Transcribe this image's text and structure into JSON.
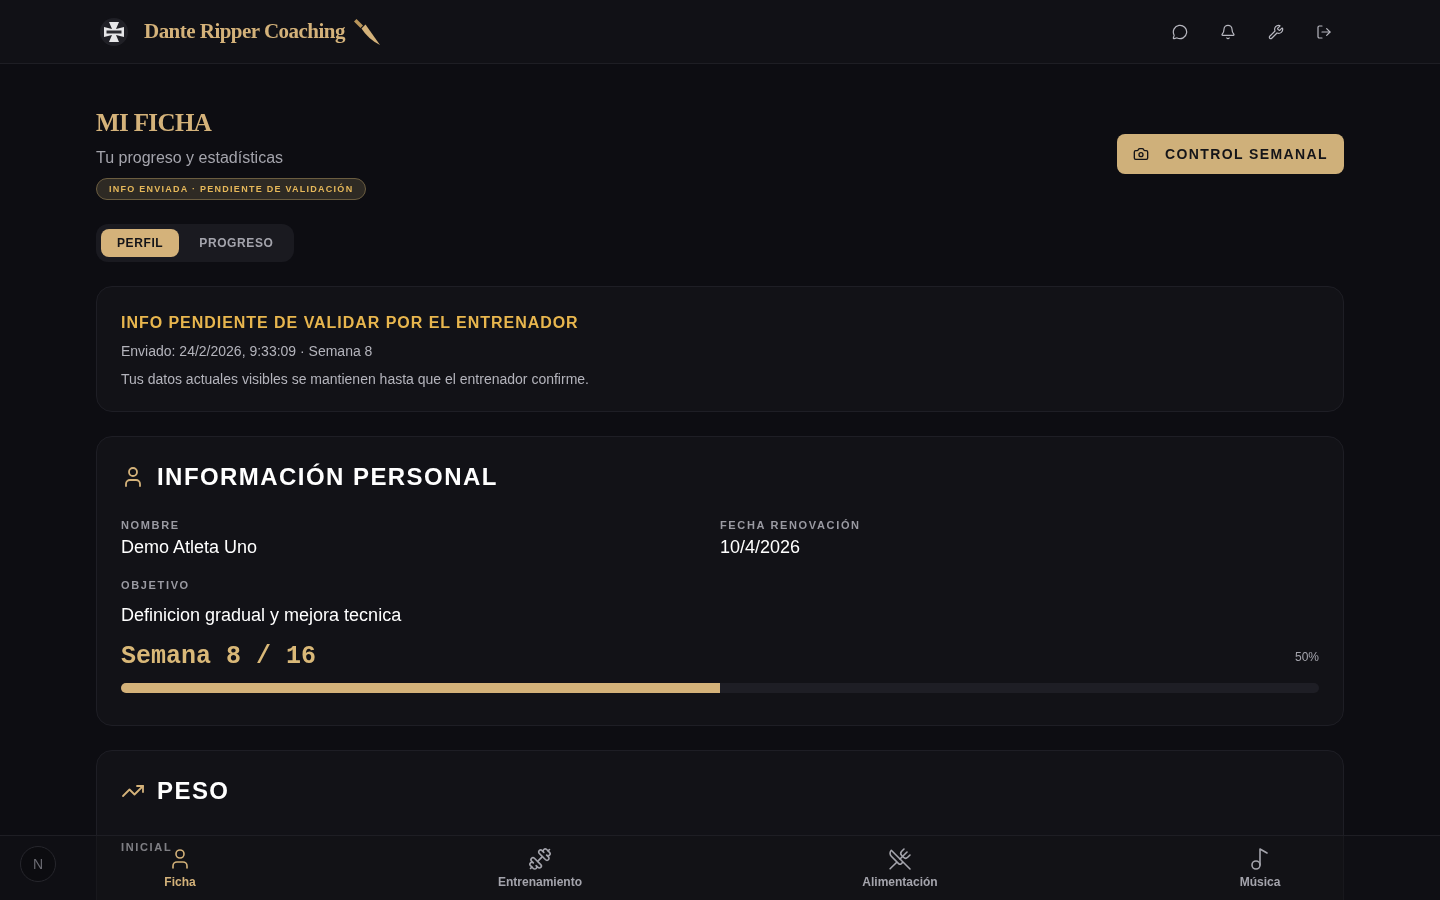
{
  "header": {
    "brand": "Dante Ripper Coaching"
  },
  "page": {
    "title": "MI FICHA",
    "subtitle": "Tu progreso y estadísticas",
    "status_badge": "INFO ENVIADA · PENDIENTE DE VALIDACIÓN",
    "primary_action": "CONTROL SEMANAL"
  },
  "tabs": [
    {
      "label": "PERFIL",
      "selected": true
    },
    {
      "label": "PROGRESO",
      "selected": false
    }
  ],
  "pending_notice": {
    "title": "INFO PENDIENTE DE VALIDAR POR EL ENTRENADOR",
    "sent": "Enviado: 24/2/2026, 9:33:09 · Semana 8",
    "note": "Tus datos actuales visibles se mantienen hasta que el entrenador confirme."
  },
  "personal_info": {
    "title": "INFORMACIÓN PERSONAL",
    "fields": [
      {
        "label": "NOMBRE",
        "value": "Demo Atleta Uno"
      },
      {
        "label": "FECHA RENOVACIÓN",
        "value": "10/4/2026"
      }
    ],
    "objective": {
      "label": "OBJETIVO",
      "value": "Definicion gradual y mejora tecnica"
    },
    "week": {
      "label": "Semana 8 / 16",
      "percent": "50%",
      "level": 0.5
    }
  },
  "weight": {
    "title": "PESO",
    "fields": [
      {
        "label": "INICIAL"
      }
    ]
  },
  "bottom_nav": [
    {
      "label": "Ficha",
      "selected": true
    },
    {
      "label": "Entrenamiento",
      "selected": false
    },
    {
      "label": "Alimentación",
      "selected": false
    },
    {
      "label": "Música",
      "selected": false
    }
  ],
  "dev_badge": {
    "letter": "N"
  }
}
